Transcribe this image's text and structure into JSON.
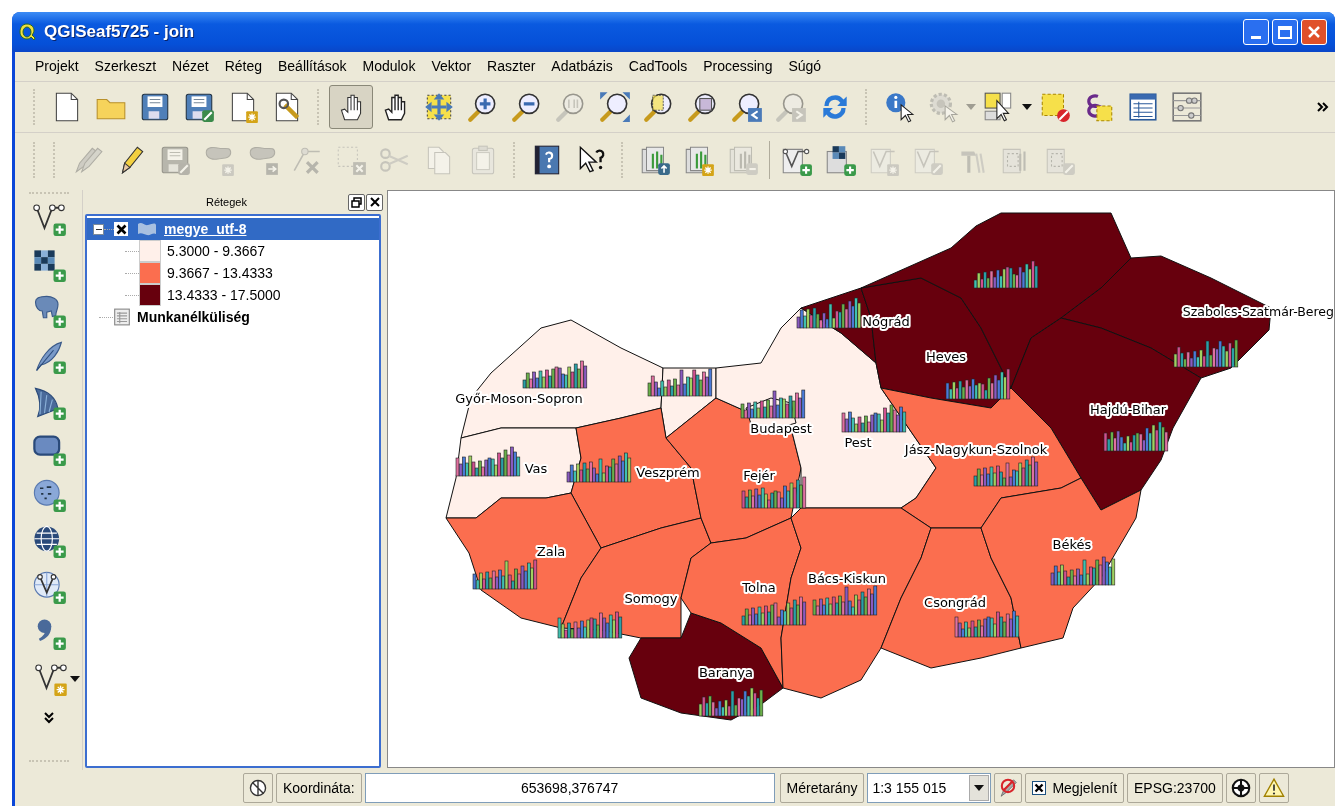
{
  "window": {
    "title": "QGISeaf5725 - join"
  },
  "menu": [
    "Projekt",
    "Szerkeszt",
    "Nézet",
    "Réteg",
    "Beállítások",
    "Modulok",
    "Vektor",
    "Raszter",
    "Adatbázis",
    "CadTools",
    "Processing",
    "Súgó"
  ],
  "toolbars": [
    {
      "items": [
        {
          "selected": false,
          "disabled": false
        },
        {
          "selected": false,
          "disabled": false
        },
        {
          "selected": false,
          "disabled": false
        },
        {
          "selected": false,
          "disabled": false
        },
        {
          "selected": false,
          "disabled": false
        },
        {
          "selected": false,
          "disabled": false
        },
        {
          "selected": true,
          "disabled": false
        },
        {
          "selected": false,
          "disabled": false
        },
        {
          "selected": false,
          "disabled": false
        },
        {
          "selected": false,
          "disabled": false
        },
        {
          "selected": false,
          "disabled": false
        },
        {
          "selected": false,
          "disabled": true
        },
        {
          "selected": false,
          "disabled": false
        },
        {
          "selected": false,
          "disabled": false
        },
        {
          "selected": false,
          "disabled": false
        },
        {
          "selected": false,
          "disabled": false
        },
        {
          "selected": false,
          "disabled": true
        },
        {
          "selected": false,
          "disabled": false
        },
        {
          "selected": false,
          "disabled": false
        },
        {
          "selected": false,
          "disabled": true
        },
        {
          "selected": false,
          "disabled": false
        },
        {
          "selected": false,
          "disabled": false
        },
        {
          "selected": false,
          "disabled": false
        },
        {
          "selected": false,
          "disabled": false
        },
        {
          "selected": false,
          "disabled": false
        }
      ]
    },
    {
      "items": [
        {
          "disabled": true
        },
        {
          "disabled": false
        },
        {
          "disabled": true
        },
        {
          "disabled": true
        },
        {
          "disabled": true
        },
        {
          "disabled": true
        },
        {
          "disabled": true
        },
        {
          "disabled": true
        },
        {
          "disabled": true
        },
        {
          "disabled": true
        },
        {
          "disabled": false
        },
        {
          "disabled": false
        },
        {
          "disabled": false
        },
        {
          "disabled": false
        },
        {
          "disabled": true
        },
        {
          "disabled": false
        },
        {
          "disabled": false
        },
        {
          "disabled": true
        },
        {
          "disabled": true
        },
        {
          "disabled": true
        },
        {
          "disabled": true
        },
        {
          "disabled": true
        }
      ]
    }
  ],
  "layers_panel": {
    "title": "Rétegek",
    "layers": [
      {
        "kind": "vector",
        "name": "megye_utf-8",
        "selected": true,
        "checked": true,
        "expanded": true,
        "children": [
          {
            "label": "5.3000 - 9.3667",
            "color": "#fff0ea"
          },
          {
            "label": "9.3667 - 13.4333",
            "color": "#fb6e4f"
          },
          {
            "label": "13.4333 - 17.5000",
            "color": "#67000d"
          }
        ]
      },
      {
        "kind": "table",
        "name": "Munkanélküliség",
        "selected": false
      }
    ]
  },
  "map": {
    "counties": [
      {
        "name": "Győr-Moson-Sopron",
        "color": "#fff0ea"
      },
      {
        "color": "#fff0ea"
      },
      {
        "name": "Vas",
        "color": "#fff0ea"
      },
      {
        "name": "Veszprém",
        "color": "#fb6e4f"
      },
      {
        "name": "Zala",
        "color": "#fb6e4f"
      },
      {
        "name": "Somogy",
        "color": "#fb6e4f"
      },
      {
        "name": "Baranya",
        "color": "#67000d"
      },
      {
        "name": "Fejér",
        "color": "#fb6e4f"
      },
      {
        "name": "Tolna",
        "color": "#fb6e4f"
      },
      {
        "name": "Pest",
        "color": "#fff0ea"
      },
      {
        "name": "Budapest",
        "color": "#fff0ea"
      },
      {
        "name": "Nógrád",
        "color": "#67000d"
      },
      {
        "name": "Heves",
        "color": "#67000d"
      },
      {
        "color": "#67000d"
      },
      {
        "name": "Szabolcs-Szatmár-Bereg",
        "color": "#67000d"
      },
      {
        "name": "Hajdú-Bihar",
        "color": "#67000d"
      },
      {
        "name": "Jász-Nagykun-Szolnok",
        "color": "#fb6e4f"
      },
      {
        "name": "Bács-Kiskun",
        "color": "#fb6e4f"
      },
      {
        "name": "Csongrád",
        "color": "#fb6e4f"
      },
      {
        "name": "Békés",
        "color": "#fb6e4f"
      }
    ]
  },
  "status_bar": {
    "coordinate_label": "Koordináta:",
    "coordinate": "653698,376747",
    "scale_label": "Méretarány",
    "scale": "1:3 155 015",
    "render_label": "Megjelenít",
    "render": true,
    "crs": "EPSG:23700"
  }
}
